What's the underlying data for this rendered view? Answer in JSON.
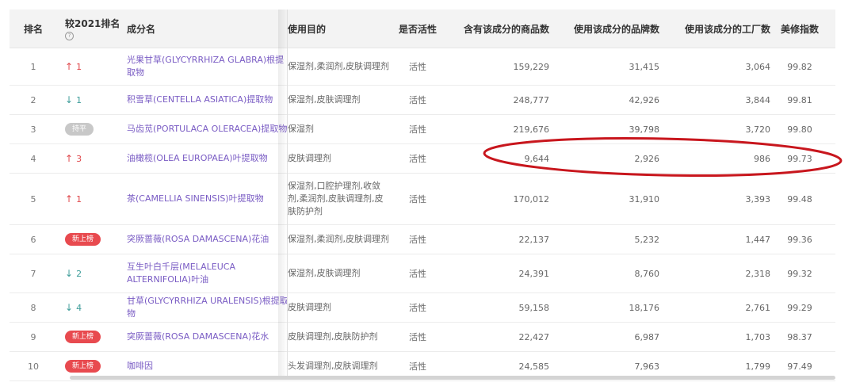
{
  "headers": {
    "rank": "排名",
    "change": "较2021排名",
    "help": "?",
    "name": "成分名",
    "purpose": "使用目的",
    "active": "是否活性",
    "products": "含有该成分的商品数",
    "brands": "使用该成分的品牌数",
    "factories": "使用该成分的工厂数",
    "index": "美修指数"
  },
  "rows": [
    {
      "rank": "1",
      "change_type": "up",
      "arrow": "↑",
      "change": "1",
      "name": "光果甘草(GLYCYRRHIZA GLABRA)根提取物",
      "purpose": "保湿剂,柔润剂,皮肤调理剂",
      "active": "活性",
      "products": "159,229",
      "brands": "31,415",
      "factories": "3,064",
      "index": "99.82"
    },
    {
      "rank": "2",
      "change_type": "down",
      "arrow": "↓",
      "change": "1",
      "name": "积雪草(CENTELLA ASIATICA)提取物",
      "purpose": "保湿剂,皮肤调理剂",
      "active": "活性",
      "products": "248,777",
      "brands": "42,926",
      "factories": "3,844",
      "index": "99.81"
    },
    {
      "rank": "3",
      "change_type": "flat",
      "badge": "持平",
      "name": "马齿苋(PORTULACA OLERACEA)提取物",
      "purpose": "保湿剂",
      "active": "活性",
      "products": "219,676",
      "brands": "39,798",
      "factories": "3,720",
      "index": "99.80"
    },
    {
      "rank": "4",
      "change_type": "up",
      "arrow": "↑",
      "change": "3",
      "name": "油橄榄(OLEA EUROPAEA)叶提取物",
      "purpose": "皮肤调理剂",
      "active": "活性",
      "products": "9,644",
      "brands": "2,926",
      "factories": "986",
      "index": "99.73"
    },
    {
      "rank": "5",
      "change_type": "up",
      "arrow": "↑",
      "change": "1",
      "name": "茶(CAMELLIA SINENSIS)叶提取物",
      "purpose": "保湿剂,口腔护理剂,收敛剂,柔润剂,皮肤调理剂,皮肤防护剂",
      "active": "活性",
      "products": "170,012",
      "brands": "31,910",
      "factories": "3,393",
      "index": "99.48"
    },
    {
      "rank": "6",
      "change_type": "new",
      "badge": "新上榜",
      "name": "突厥蔷薇(ROSA DAMASCENA)花油",
      "purpose": "保湿剂,柔润剂,皮肤调理剂",
      "active": "活性",
      "products": "22,137",
      "brands": "5,232",
      "factories": "1,447",
      "index": "99.36"
    },
    {
      "rank": "7",
      "change_type": "down",
      "arrow": "↓",
      "change": "2",
      "name": "互生叶白千层(MELALEUCA ALTERNIFOLIA)叶油",
      "purpose": "保湿剂,皮肤调理剂",
      "active": "活性",
      "products": "24,391",
      "brands": "8,760",
      "factories": "2,318",
      "index": "99.32"
    },
    {
      "rank": "8",
      "change_type": "down",
      "arrow": "↓",
      "change": "4",
      "name": "甘草(GLYCYRRHIZA URALENSIS)根提取物",
      "purpose": "皮肤调理剂",
      "active": "活性",
      "products": "59,158",
      "brands": "18,176",
      "factories": "2,761",
      "index": "99.29"
    },
    {
      "rank": "9",
      "change_type": "new",
      "badge": "新上榜",
      "name": "突厥蔷薇(ROSA DAMASCENA)花水",
      "purpose": "皮肤调理剂,皮肤防护剂",
      "active": "活性",
      "products": "22,427",
      "brands": "6,987",
      "factories": "1,703",
      "index": "98.37"
    },
    {
      "rank": "10",
      "change_type": "new",
      "badge": "新上榜",
      "name": "咖啡因",
      "purpose": "头发调理剂,皮肤调理剂",
      "active": "活性",
      "products": "24,585",
      "brands": "7,963",
      "factories": "1,799",
      "index": "97.49"
    }
  ],
  "colors": {
    "up": "#e0484c",
    "down": "#3e9d9a",
    "name_link": "#7a5cc4",
    "new_badge": "#e84a4f",
    "flat_badge": "#c8c8c8",
    "annotation_ellipse": "#c8161d"
  },
  "annotation": {
    "shape": "ellipse",
    "highlights_row_rank": "4"
  }
}
